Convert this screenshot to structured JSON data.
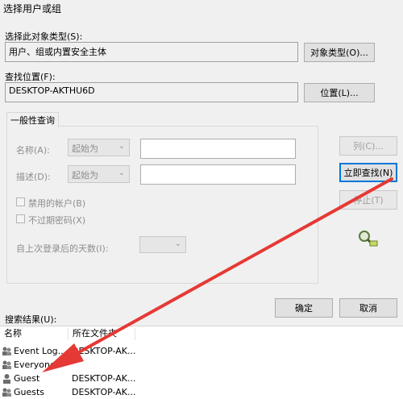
{
  "window": {
    "title": "选择用户或组"
  },
  "object_type": {
    "label": "选择此对象类型(S):",
    "value": "用户、组或内置安全主体",
    "button": "对象类型(O)..."
  },
  "location": {
    "label": "查找位置(F):",
    "value": "DESKTOP-AKTHU6D",
    "button": "位置(L)..."
  },
  "tab": {
    "label": "一般性查询"
  },
  "query": {
    "name_label": "名称(A):",
    "name_combo": "起始为",
    "desc_label": "描述(D):",
    "desc_combo": "起始为",
    "disabled_accounts": "禁用的帐户(B)",
    "non_expiring_pw": "不过期密码(X)",
    "days_label": "自上次登录后的天数(I):"
  },
  "buttons": {
    "columns": "列(C)...",
    "find_now": "立即查找(N)",
    "stop": "停止(T)",
    "ok": "确定",
    "cancel": "取消"
  },
  "results": {
    "label": "搜索结果(U):",
    "headers": [
      "名称",
      "所在文件夹"
    ],
    "rows": [
      {
        "name": "Event Log...",
        "location": "DESKTOP-AK..."
      },
      {
        "name": "Everyone",
        "location": ""
      },
      {
        "name": "Guest",
        "location": "DESKTOP-AK..."
      },
      {
        "name": "Guests",
        "location": "DESKTOP-AK..."
      }
    ]
  },
  "colors": {
    "accent": "#0078d7",
    "arrow": "#e53935"
  }
}
